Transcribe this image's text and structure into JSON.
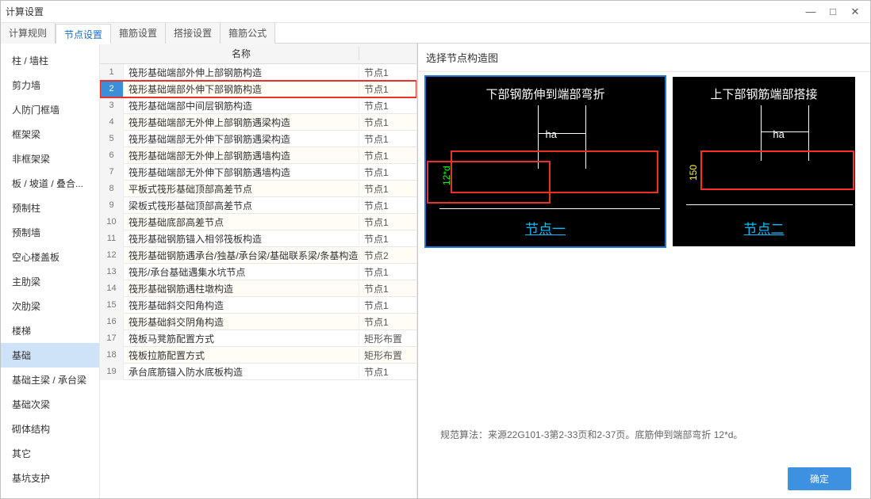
{
  "window": {
    "title": "计算设置"
  },
  "window_controls": {
    "min": "—",
    "max": "□",
    "close": "✕"
  },
  "top_tabs": [
    {
      "label": "计算规则"
    },
    {
      "label": "节点设置"
    },
    {
      "label": "箍筋设置"
    },
    {
      "label": "搭接设置"
    },
    {
      "label": "箍筋公式"
    }
  ],
  "sidebar": {
    "items": [
      "柱 / 墙柱",
      "剪力墙",
      "人防门框墙",
      "框架梁",
      "非框架梁",
      "板 / 坡道 / 叠合...",
      "预制柱",
      "预制墙",
      "空心楼盖板",
      "主肋梁",
      "次肋梁",
      "楼梯",
      "基础",
      "基础主梁 / 承台梁",
      "基础次梁",
      "砌体结构",
      "其它",
      "基坑支护"
    ]
  },
  "table": {
    "header_name": "名称",
    "rows": [
      {
        "num": "1",
        "name": "筏形基础端部外伸上部钢筋构造",
        "node": "节点1"
      },
      {
        "num": "2",
        "name": "筏形基础端部外伸下部钢筋构造",
        "node": "节点1"
      },
      {
        "num": "3",
        "name": "筏形基础端部中间层钢筋构造",
        "node": "节点1"
      },
      {
        "num": "4",
        "name": "筏形基础端部无外伸上部钢筋遇梁构造",
        "node": "节点1"
      },
      {
        "num": "5",
        "name": "筏形基础端部无外伸下部钢筋遇梁构造",
        "node": "节点1"
      },
      {
        "num": "6",
        "name": "筏形基础端部无外伸上部钢筋遇墙构造",
        "node": "节点1"
      },
      {
        "num": "7",
        "name": "筏形基础端部无外伸下部钢筋遇墙构造",
        "node": "节点1"
      },
      {
        "num": "8",
        "name": "平板式筏形基础顶部高差节点",
        "node": "节点1"
      },
      {
        "num": "9",
        "name": "梁板式筏形基础顶部高差节点",
        "node": "节点1"
      },
      {
        "num": "10",
        "name": "筏形基础底部高差节点",
        "node": "节点1"
      },
      {
        "num": "11",
        "name": "筏形基础钢筋锚入相邻筏板构造",
        "node": "节点1"
      },
      {
        "num": "12",
        "name": "筏形基础钢筋遇承台/独基/承台梁/基础联系梁/条基构造",
        "node": "节点2"
      },
      {
        "num": "13",
        "name": "筏形/承台基础遇集水坑节点",
        "node": "节点1"
      },
      {
        "num": "14",
        "name": "筏形基础钢筋遇柱墩构造",
        "node": "节点1"
      },
      {
        "num": "15",
        "name": "筏形基础斜交阳角构造",
        "node": "节点1"
      },
      {
        "num": "16",
        "name": "筏形基础斜交阴角构造",
        "node": "节点1"
      },
      {
        "num": "17",
        "name": "筏板马凳筋配置方式",
        "node": "矩形布置"
      },
      {
        "num": "18",
        "name": "筏板拉筋配置方式",
        "node": "矩形布置"
      },
      {
        "num": "19",
        "name": "承台底筋锚入防水底板构造",
        "node": "节点1"
      }
    ]
  },
  "right": {
    "title": "选择节点构造图",
    "diag1": {
      "title": "下部钢筋伸到端部弯折",
      "ha": "ha",
      "vert": "12*d",
      "caption": "节点一"
    },
    "diag2": {
      "title": "上下部钢筋端部搭接",
      "ha": "ha",
      "vert": "150",
      "caption": "节点二"
    },
    "desc": "规范算法：来源22G101-3第2-33页和2-37页。底筋伸到端部弯折 12*d。",
    "ok": "确定"
  }
}
